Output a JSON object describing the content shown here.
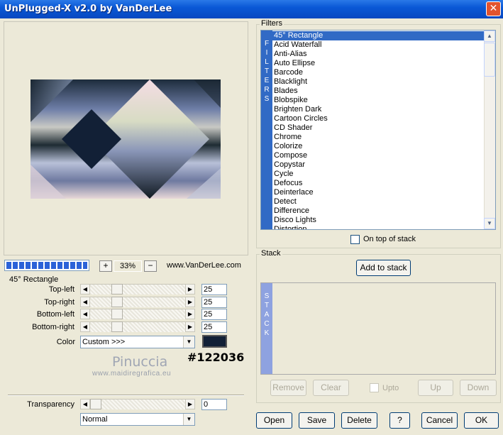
{
  "window": {
    "title": "UnPlugged-X v2.0 by VanDerLee",
    "close_symbol": "✕"
  },
  "filters": {
    "group_label": "Filters",
    "strip_text": "FILTERS",
    "items": [
      "45° Rectangle",
      "Acid Waterfall",
      "Anti-Alias",
      "Auto Ellipse",
      "Barcode",
      "Blacklight",
      "Blades",
      "Blobspike",
      "Brighten Dark",
      "Cartoon Circles",
      "CD Shader",
      "Chrome",
      "Colorize",
      "Compose",
      "Copystar",
      "Cycle",
      "Defocus",
      "Deinterlace",
      "Detect",
      "Difference",
      "Disco Lights",
      "Distortion"
    ],
    "selected": "45° Rectangle",
    "on_top_label": "On top of stack",
    "on_top_checked": false
  },
  "preview": {
    "zoom_value": "33%",
    "zoom_in": "+",
    "zoom_out": "−",
    "site": "www.VanDerLee.com",
    "progress": 1.0
  },
  "params": {
    "group_label": "45° Rectangle",
    "sliders": [
      {
        "label": "Top-left",
        "value": "25",
        "fraction": 0.25
      },
      {
        "label": "Top-right",
        "value": "25",
        "fraction": 0.25
      },
      {
        "label": "Bottom-left",
        "value": "25",
        "fraction": 0.25
      },
      {
        "label": "Bottom-right",
        "value": "25",
        "fraction": 0.25
      }
    ],
    "color_label": "Color",
    "color_option": "Custom >>>",
    "color_hex_label": "#122036",
    "swatch_color": "#122036"
  },
  "watermark": {
    "name": "Pinuccia",
    "url": "www.maidiregrafica.eu"
  },
  "transparency": {
    "label": "Transparency",
    "value": "0",
    "fraction": 0.0,
    "blend_mode": "Normal"
  },
  "stack": {
    "group_label": "Stack",
    "add_button": "Add to stack",
    "strip_text": "STACK",
    "remove_button": "Remove",
    "clear_button": "Clear",
    "upto_label": "Upto",
    "up_button": "Up",
    "down_button": "Down"
  },
  "footer": {
    "open": "Open",
    "save": "Save",
    "delete": "Delete",
    "help": "?",
    "cancel": "Cancel",
    "ok": "OK"
  },
  "colors": {
    "title_bar": "#0a58d6",
    "selection": "#316ac5",
    "swatch": "#122036"
  }
}
